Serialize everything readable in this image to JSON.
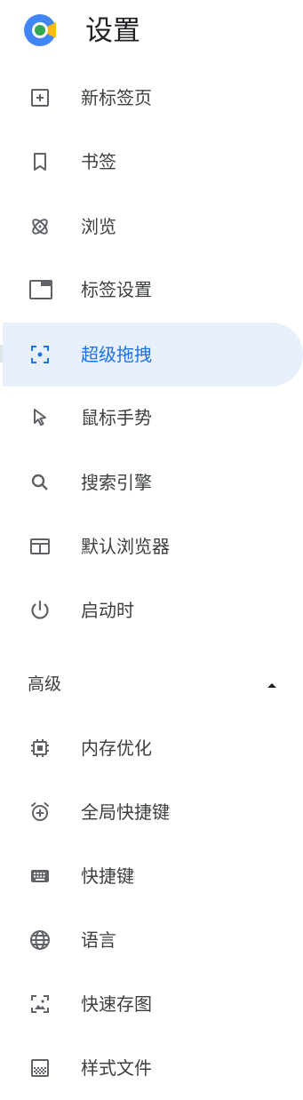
{
  "header": {
    "title": "设置",
    "logo_icon": "app-logo-icon"
  },
  "colors": {
    "accent": "#1a73e8",
    "active_bg": "#e8f0fe",
    "icon": "#5f6368",
    "text": "#3c4043"
  },
  "nav": {
    "items": [
      {
        "label": "新标签页",
        "icon": "new-tab-icon"
      },
      {
        "label": "书签",
        "icon": "bookmark-icon"
      },
      {
        "label": "浏览",
        "icon": "atom-icon"
      },
      {
        "label": "标签设置",
        "icon": "tab-window-icon"
      },
      {
        "label": "超级拖拽",
        "icon": "drag-target-icon",
        "active": true
      },
      {
        "label": "鼠标手势",
        "icon": "mouse-pointer-icon"
      },
      {
        "label": "搜索引擎",
        "icon": "search-icon"
      },
      {
        "label": "默认浏览器",
        "icon": "browser-window-icon"
      },
      {
        "label": "启动时",
        "icon": "power-icon"
      }
    ],
    "advanced": {
      "label": "高级",
      "expanded": true,
      "items": [
        {
          "label": "内存优化",
          "icon": "memory-chip-icon"
        },
        {
          "label": "全局快捷键",
          "icon": "alarm-add-icon"
        },
        {
          "label": "快捷键",
          "icon": "keyboard-icon"
        },
        {
          "label": "语言",
          "icon": "globe-icon"
        },
        {
          "label": "快速存图",
          "icon": "save-image-icon"
        },
        {
          "label": "样式文件",
          "icon": "texture-icon"
        }
      ]
    }
  }
}
